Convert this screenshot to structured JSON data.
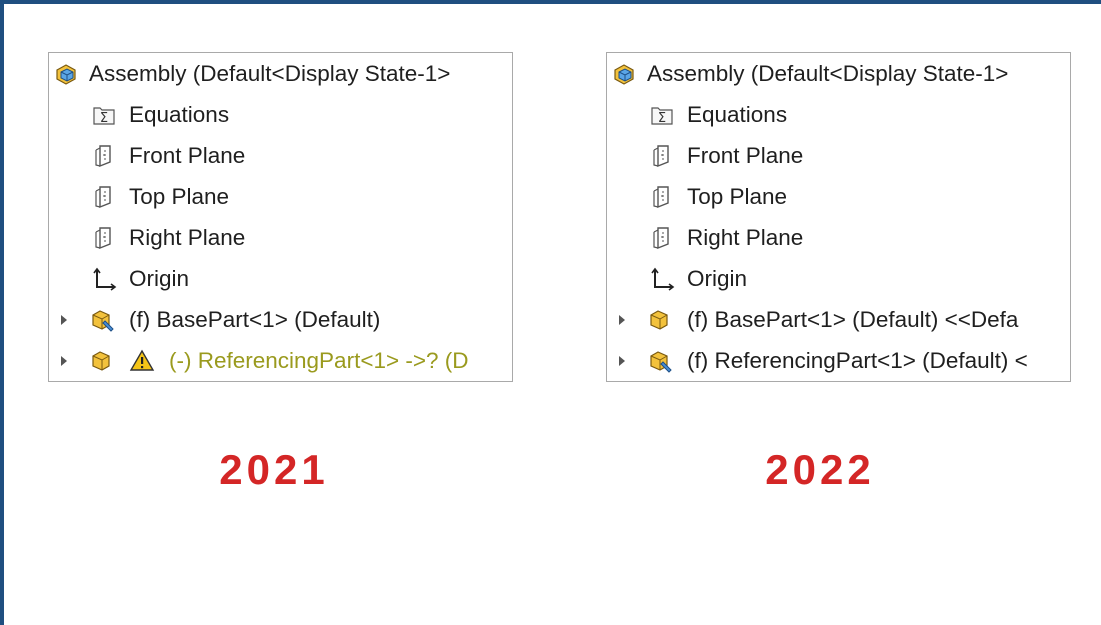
{
  "colors": {
    "frame_border": "#1f4f80",
    "year_label": "#d42626",
    "warning_text": "#9a9a1e"
  },
  "panels": [
    {
      "root": {
        "label": "Assembly  (Default<Display State-1>",
        "icon": "assembly-icon"
      },
      "items": [
        {
          "label": "Equations",
          "icon": "equations-icon"
        },
        {
          "label": "Front Plane",
          "icon": "plane-icon"
        },
        {
          "label": "Top Plane",
          "icon": "plane-icon"
        },
        {
          "label": "Right Plane",
          "icon": "plane-icon"
        },
        {
          "label": "Origin",
          "icon": "origin-icon"
        },
        {
          "label": "(f) BasePart<1> (Default)",
          "icon": "part-icon"
        },
        {
          "label": "(-) ReferencingPart<1> ->? (D",
          "icon": "part-icon",
          "warning_icon": "warning-icon"
        }
      ],
      "year": "2021"
    },
    {
      "root": {
        "label": "Assembly  (Default<Display State-1>",
        "icon": "assembly-icon"
      },
      "items": [
        {
          "label": "Equations",
          "icon": "equations-icon"
        },
        {
          "label": "Front Plane",
          "icon": "plane-icon"
        },
        {
          "label": "Top Plane",
          "icon": "plane-icon"
        },
        {
          "label": "Right Plane",
          "icon": "plane-icon"
        },
        {
          "label": "Origin",
          "icon": "origin-icon"
        },
        {
          "label": "(f) BasePart<1> (Default) <<Defa",
          "icon": "part-icon"
        },
        {
          "label": "(f) ReferencingPart<1> (Default) <",
          "icon": "part-icon"
        }
      ],
      "year": "2022"
    }
  ]
}
